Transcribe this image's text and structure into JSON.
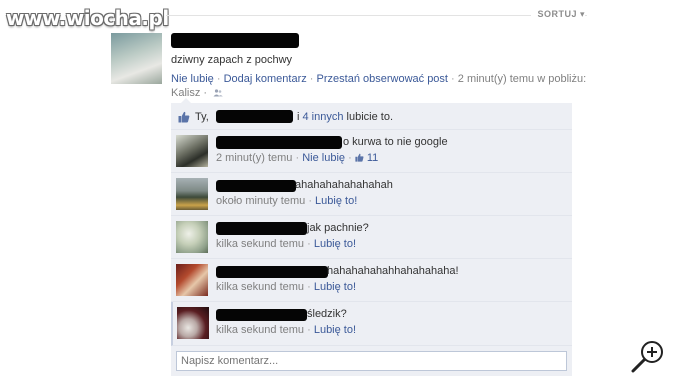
{
  "watermark": "www.wiocha.pl",
  "sort_label": "SORTUJ ▾",
  "post": {
    "message": "dziwny zapach z pochwy",
    "actions": {
      "unlike": "Nie lubię",
      "comment": "Dodaj komentarz",
      "unfollow": "Przestań obserwować post",
      "time": "2 minut(y) temu w pobliżu:"
    },
    "location": "Kalisz",
    "privacy_icon": "friends-icon"
  },
  "likes": {
    "prefix": "Ty,",
    "others_link": "4 innych",
    "suffix": " lubicie to."
  },
  "comments": [
    {
      "text": "o kurwa to nie google",
      "time": "2 minut(y) temu",
      "like_label": "Nie lubię",
      "like_count": "11"
    },
    {
      "text": "ahahahahahahahah",
      "time": "około minuty temu",
      "like_label": "Lubię to!"
    },
    {
      "text": "jak pachnie?",
      "time": "kilka sekund temu",
      "like_label": "Lubię to!"
    },
    {
      "text": "hahahahahahhahahahaha!",
      "time": "kilka sekund temu",
      "like_label": "Lubię to!"
    },
    {
      "text": "śledzik?",
      "time": "kilka sekund temu",
      "like_label": "Lubię to!"
    }
  ],
  "comment_input": {
    "placeholder": "Napisz komentarz..."
  },
  "colors": {
    "link": "#3b5998",
    "box_bg": "#edeff4",
    "border": "#bdc7d8"
  },
  "sep": " · "
}
